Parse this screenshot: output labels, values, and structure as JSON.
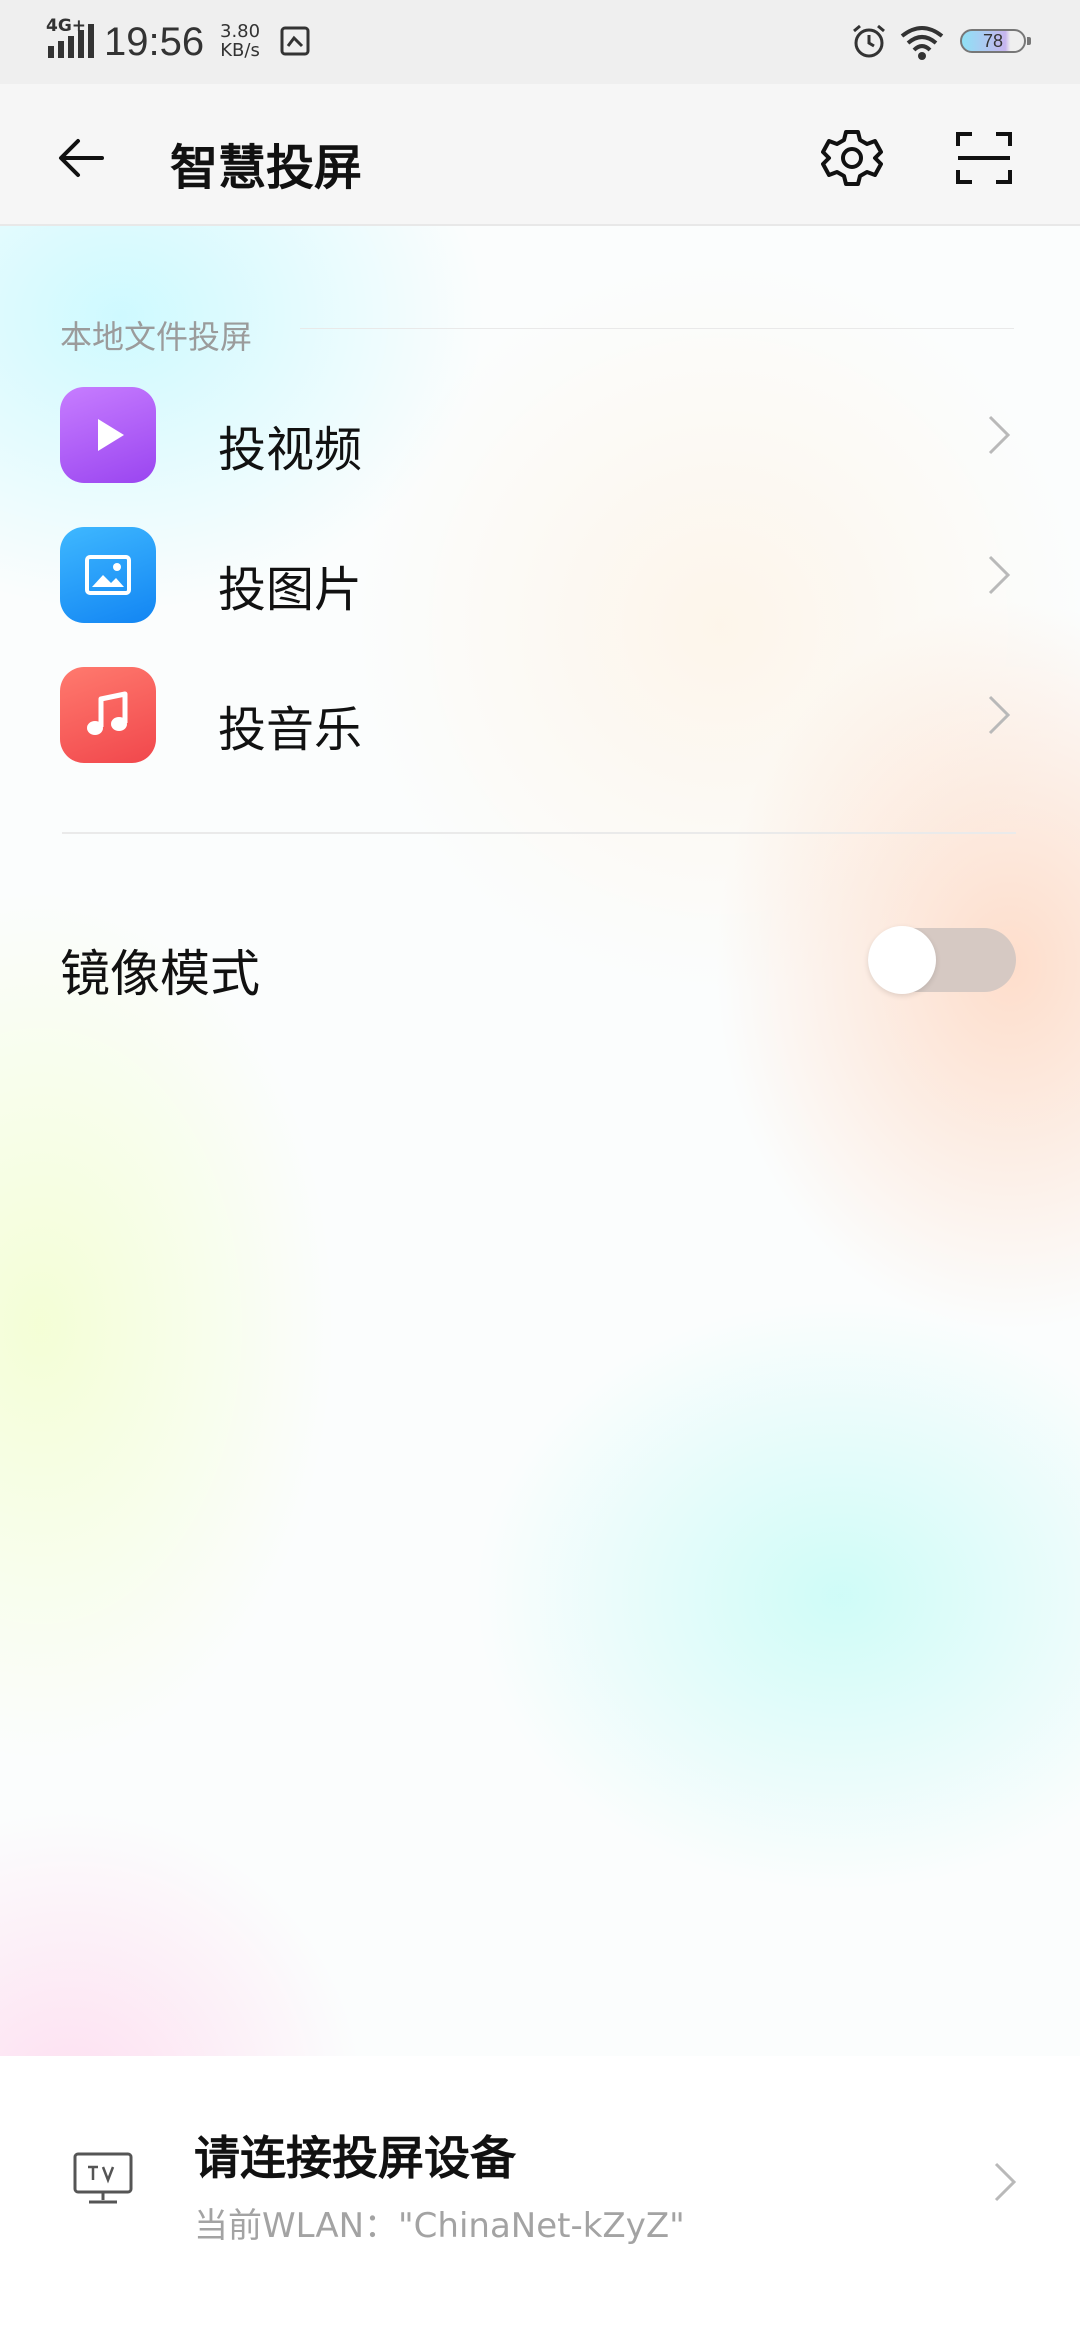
{
  "status_bar": {
    "network": "4G+",
    "time": "19:56",
    "speed_value": "3.80",
    "speed_unit": "KB/s",
    "battery": "78",
    "icons": [
      "signal-icon",
      "screenshot-icon",
      "alarm-icon",
      "wifi-icon",
      "battery-icon"
    ]
  },
  "app_bar": {
    "title": "智慧投屏",
    "icons": [
      "back-arrow-icon",
      "gear-icon",
      "scan-icon"
    ]
  },
  "local_files": {
    "header": "本地文件投屏",
    "items": [
      {
        "label": "投视频",
        "icon": "play-icon",
        "color": "#a855f7"
      },
      {
        "label": "投图片",
        "icon": "image-icon",
        "color": "#1e9bff"
      },
      {
        "label": "投音乐",
        "icon": "music-note-icon",
        "color": "#f75a5a"
      }
    ]
  },
  "mirror_mode": {
    "label": "镜像模式",
    "enabled": false
  },
  "connect_panel": {
    "title": "请连接投屏设备",
    "subtitle": "当前WLAN：\"ChinaNet-kZyZ\"",
    "icon": "tv-icon"
  }
}
